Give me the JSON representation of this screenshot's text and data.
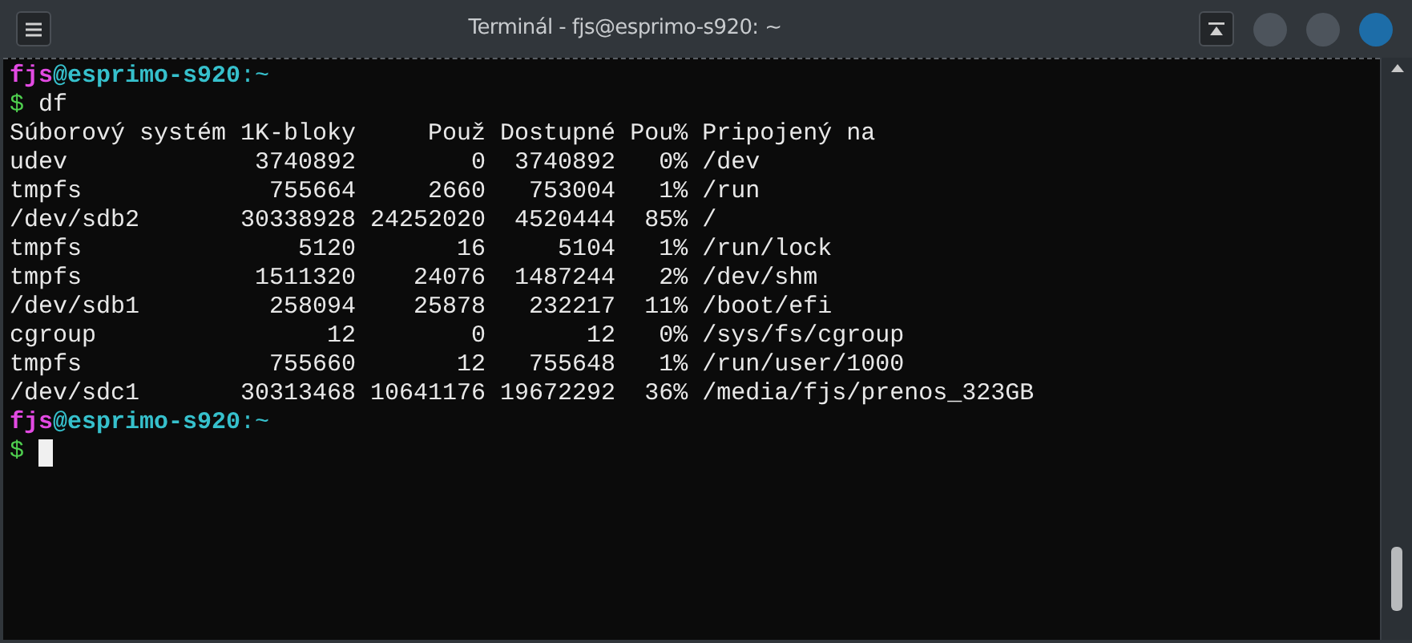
{
  "window": {
    "title": "Terminál - fjs@esprimo-s920: ~"
  },
  "terminal": {
    "lines": [
      {
        "kind": "prompt",
        "user": "fjs",
        "host": "@esprimo-s920",
        "path": ":~"
      },
      {
        "kind": "command",
        "symbol": "$",
        "text": "df"
      },
      {
        "kind": "output",
        "text": "Súborový systém 1K-bloky     Použ Dostupné Pou% Pripojený na"
      },
      {
        "kind": "output",
        "text": "udev             3740892        0  3740892   0% /dev"
      },
      {
        "kind": "output",
        "text": "tmpfs             755664     2660   753004   1% /run"
      },
      {
        "kind": "output",
        "text": "/dev/sdb2       30338928 24252020  4520444  85% /"
      },
      {
        "kind": "output",
        "text": "tmpfs               5120       16     5104   1% /run/lock"
      },
      {
        "kind": "output",
        "text": "tmpfs            1511320    24076  1487244   2% /dev/shm"
      },
      {
        "kind": "output",
        "text": "/dev/sdb1         258094    25878   232217  11% /boot/efi"
      },
      {
        "kind": "output",
        "text": "cgroup                12        0       12   0% /sys/fs/cgroup"
      },
      {
        "kind": "output",
        "text": "tmpfs             755660       12   755648   1% /run/user/1000"
      },
      {
        "kind": "output",
        "text": "/dev/sdc1       30313468 10641176 19672292  36% /media/fjs/prenos_323GB"
      },
      {
        "kind": "prompt",
        "user": "fjs",
        "host": "@esprimo-s920",
        "path": ":~"
      },
      {
        "kind": "input",
        "symbol": "$"
      }
    ]
  }
}
